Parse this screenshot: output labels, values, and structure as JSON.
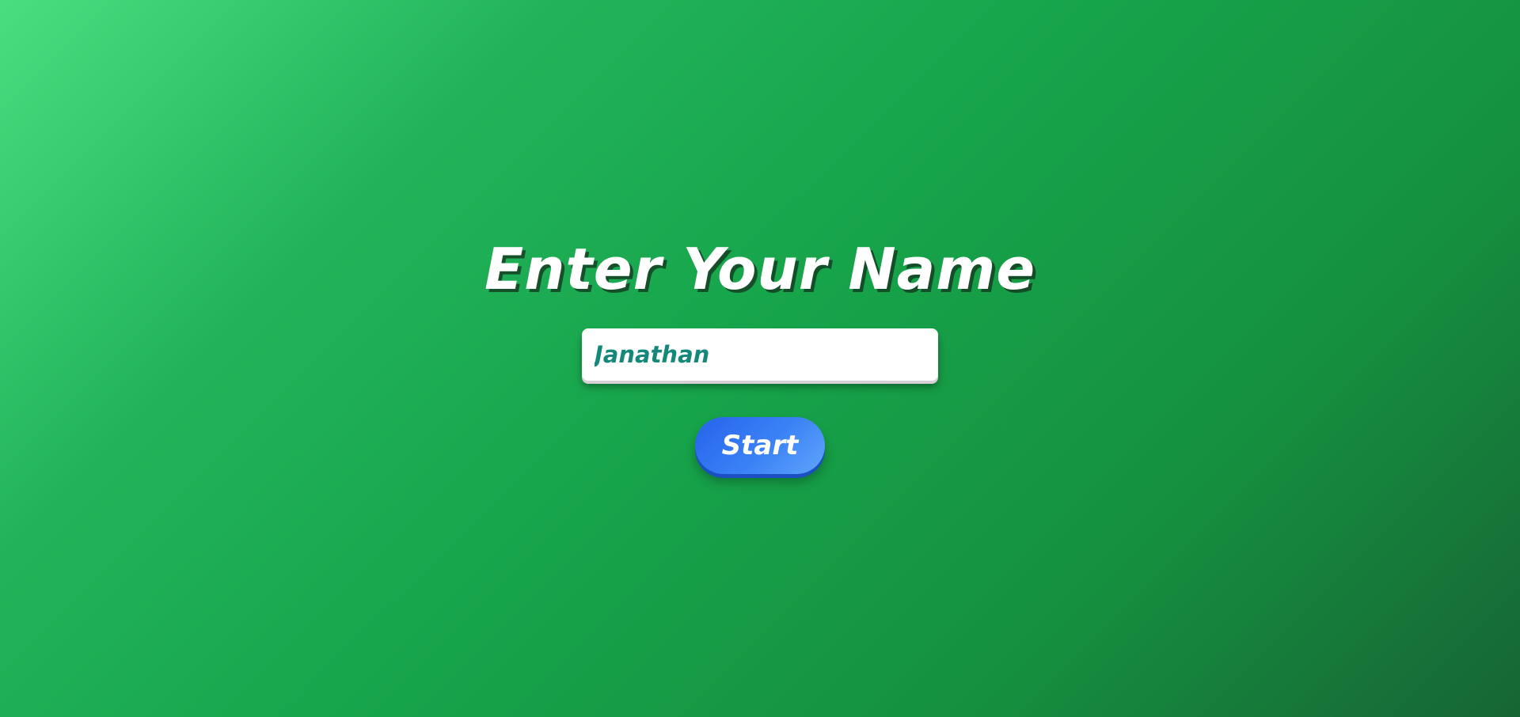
{
  "screen": {
    "title": "Enter Your Name",
    "name_input": {
      "value": "Janathan",
      "placeholder": ""
    },
    "start_label": "Start"
  },
  "colors": {
    "background_start": "#4ade80",
    "background_end": "#166534",
    "title_text": "#ffffff",
    "input_text": "#16887a",
    "button_start": "#2563eb",
    "button_end": "#60a5fa"
  }
}
